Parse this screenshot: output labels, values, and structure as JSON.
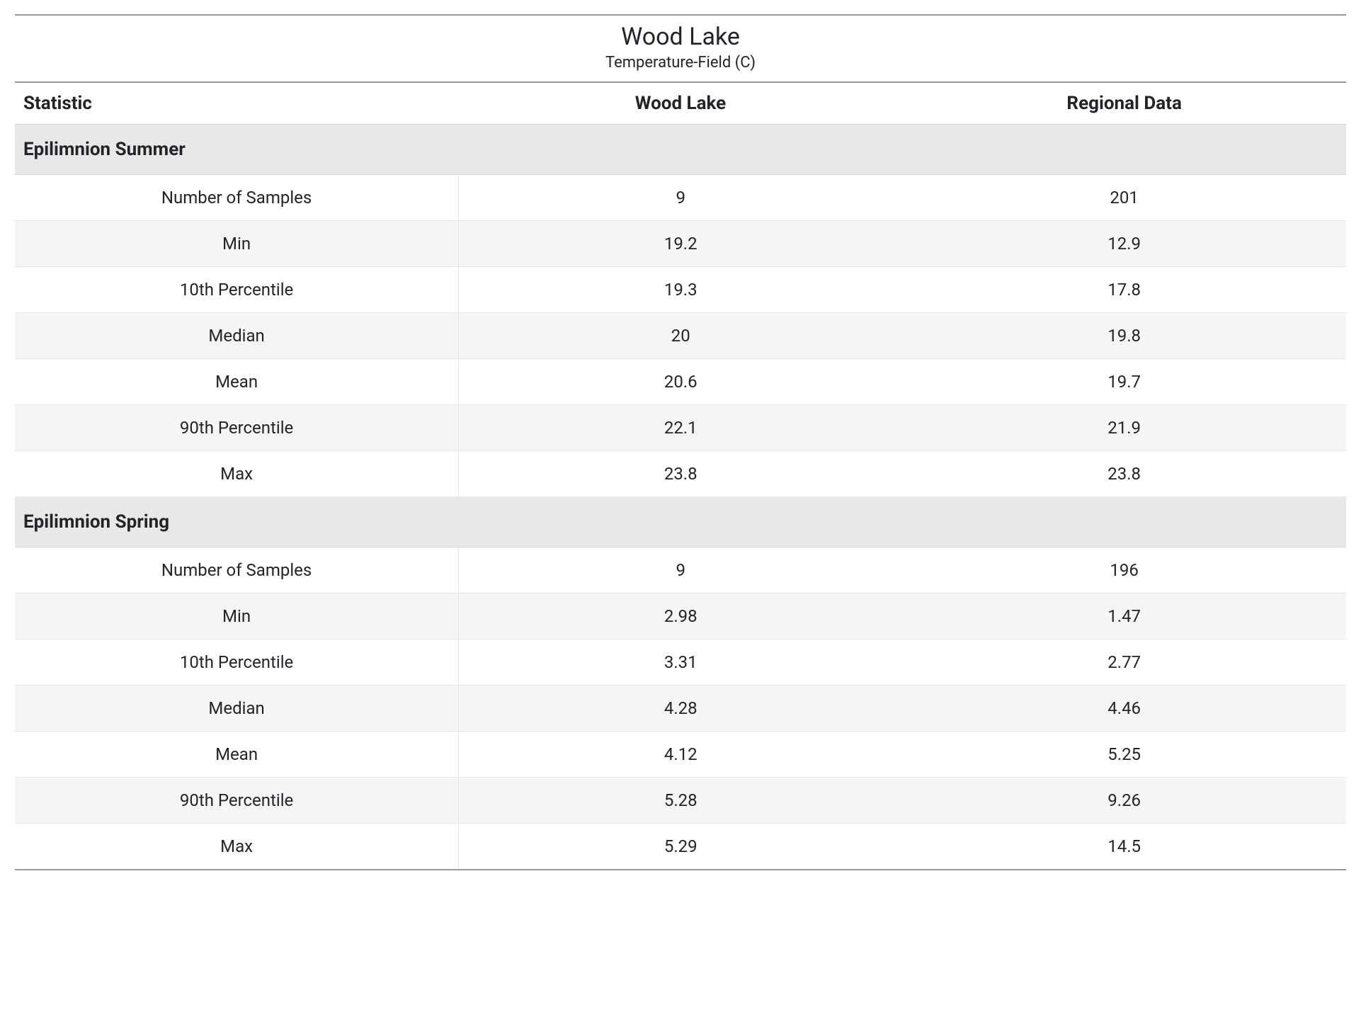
{
  "header": {
    "title": "Wood Lake",
    "subtitle": "Temperature-Field (C)"
  },
  "columns": {
    "stat": "Statistic",
    "local": "Wood Lake",
    "regional": "Regional Data"
  },
  "groups": [
    {
      "name": "Epilimnion Summer",
      "rows": [
        {
          "stat": "Number of Samples",
          "local": "9",
          "regional": "201"
        },
        {
          "stat": "Min",
          "local": "19.2",
          "regional": "12.9"
        },
        {
          "stat": "10th Percentile",
          "local": "19.3",
          "regional": "17.8"
        },
        {
          "stat": "Median",
          "local": "20",
          "regional": "19.8"
        },
        {
          "stat": "Mean",
          "local": "20.6",
          "regional": "19.7"
        },
        {
          "stat": "90th Percentile",
          "local": "22.1",
          "regional": "21.9"
        },
        {
          "stat": "Max",
          "local": "23.8",
          "regional": "23.8"
        }
      ]
    },
    {
      "name": "Epilimnion Spring",
      "rows": [
        {
          "stat": "Number of Samples",
          "local": "9",
          "regional": "196"
        },
        {
          "stat": "Min",
          "local": "2.98",
          "regional": "1.47"
        },
        {
          "stat": "10th Percentile",
          "local": "3.31",
          "regional": "2.77"
        },
        {
          "stat": "Median",
          "local": "4.28",
          "regional": "4.46"
        },
        {
          "stat": "Mean",
          "local": "4.12",
          "regional": "5.25"
        },
        {
          "stat": "90th Percentile",
          "local": "5.28",
          "regional": "9.26"
        },
        {
          "stat": "Max",
          "local": "5.29",
          "regional": "14.5"
        }
      ]
    }
  ]
}
